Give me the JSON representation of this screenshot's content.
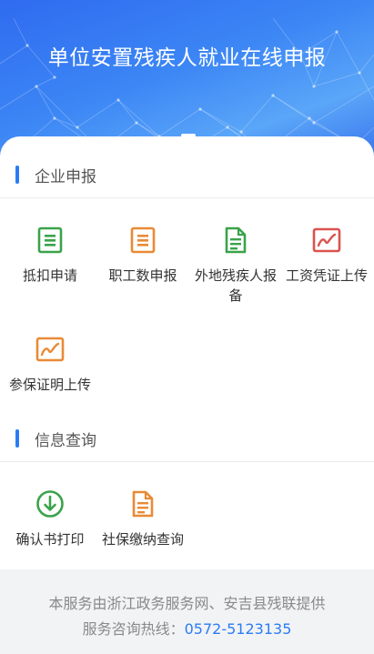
{
  "header": {
    "title": "单位安置残疾人就业在线申报"
  },
  "sections": [
    {
      "title": "企业申报",
      "items": [
        {
          "label": "抵扣申请",
          "icon": "list-doc-icon",
          "color": "#3aa34a"
        },
        {
          "label": "职工数申报",
          "icon": "list-doc-icon",
          "color": "#e98a36"
        },
        {
          "label": "外地残疾人报备",
          "icon": "file-text-icon",
          "color": "#3aa34a"
        },
        {
          "label": "工资凭证上传",
          "icon": "chart-image-icon",
          "color": "#d9534f"
        },
        {
          "label": "参保证明上传",
          "icon": "chart-image-icon",
          "color": "#e98a36"
        }
      ]
    },
    {
      "title": "信息查询",
      "items": [
        {
          "label": "确认书打印",
          "icon": "download-circle-icon",
          "color": "#3aa34a"
        },
        {
          "label": "社保缴纳查询",
          "icon": "file-text-icon",
          "color": "#e98a36"
        }
      ]
    }
  ],
  "footer": {
    "line1": "本服务由浙江政务服务网、安吉县残联提供",
    "hotline_label": "服务咨询热线：",
    "hotline_number": "0572-5123135"
  },
  "colors": {
    "accent": "#2a7cf5"
  }
}
